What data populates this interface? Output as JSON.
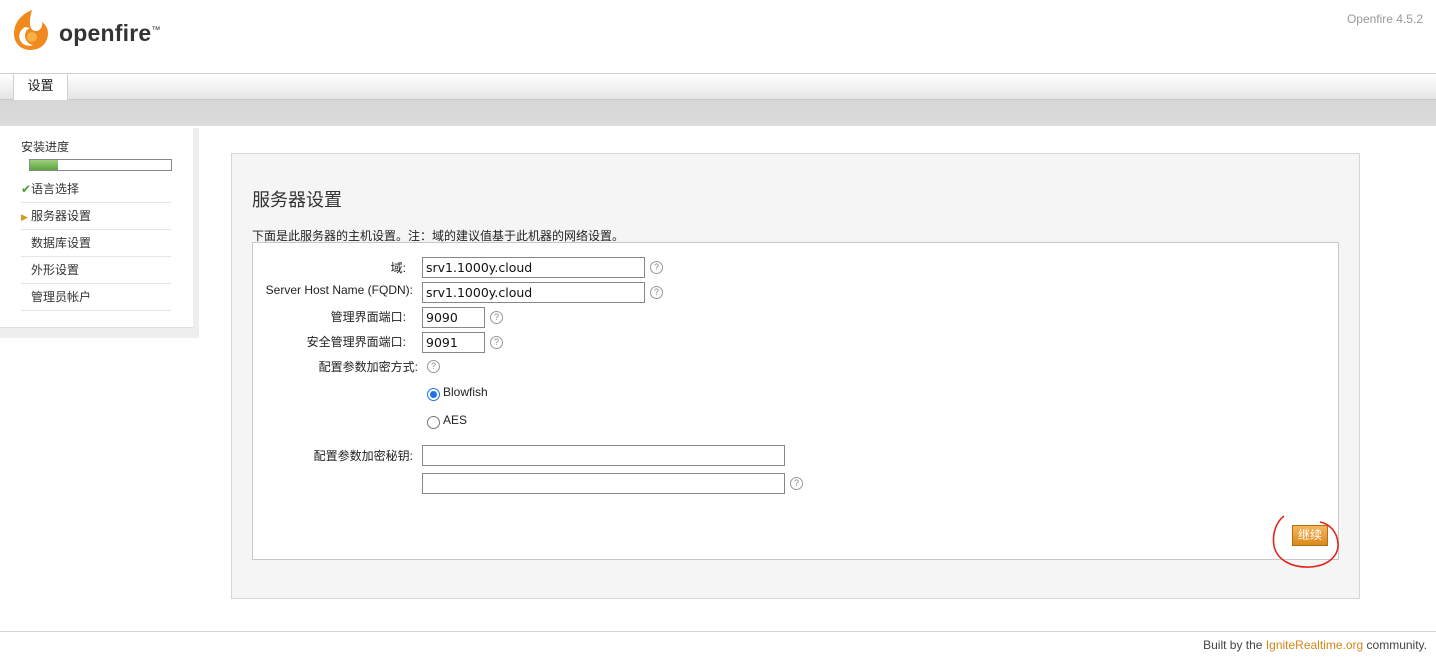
{
  "header": {
    "brand": "openfire",
    "brand_mark": "™",
    "version": "Openfire 4.5.2"
  },
  "tabs": {
    "active": "设置"
  },
  "sidebar": {
    "title": "安装进度",
    "progress_fraction": 0.2,
    "items": [
      {
        "label": "语言选择",
        "status": "done"
      },
      {
        "label": "服务器设置",
        "status": "current"
      },
      {
        "label": "数据库设置",
        "status": "pending"
      },
      {
        "label": "外形设置",
        "status": "pending"
      },
      {
        "label": "管理员帐户",
        "status": "pending"
      }
    ]
  },
  "main": {
    "title": "服务器设置",
    "description": "下面是此服务器的主机设置。注：域的建议值基于此机器的网络设置。",
    "fields": {
      "domain_label": "域:",
      "domain_value": "srv1.1000y.cloud",
      "fqdn_label": "Server Host Name (FQDN):",
      "fqdn_value": "srv1.1000y.cloud",
      "admin_port_label": "管理界面端口:",
      "admin_port_value": "9090",
      "secure_port_label": "安全管理界面端口:",
      "secure_port_value": "9091",
      "encryption_label": "配置参数加密方式:",
      "encryption_options": [
        "Blowfish",
        "AES"
      ],
      "encryption_selected": "Blowfish",
      "key_label": "配置参数加密秘钥:",
      "key_value": "",
      "key_confirm_value": ""
    },
    "continue_label": "继续"
  },
  "footer": {
    "prefix": "Built by the ",
    "link": "IgniteRealtime.org",
    "suffix": " community."
  },
  "colors": {
    "accent": "#d98a1c",
    "progress": "#5aa53b",
    "annotation": "#e0261b"
  }
}
